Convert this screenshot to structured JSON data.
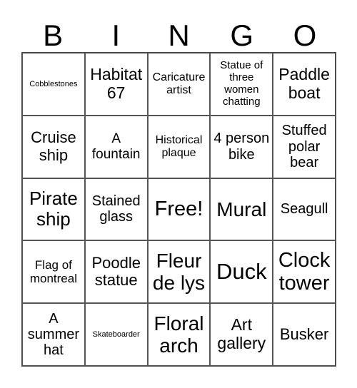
{
  "header": {
    "letters": [
      "B",
      "I",
      "N",
      "G",
      "O"
    ]
  },
  "cells": [
    "Cobblestones",
    "Habitat 67",
    "Caricature artist",
    "Statue of three women chatting",
    "Paddle boat",
    "Cruise ship",
    "A fountain",
    "Historical plaque",
    "4 person bike",
    "Stuffed polar bear",
    "Pirate ship",
    "Stained glass",
    "Free!",
    "Mural",
    "Seagull",
    "Flag of montreal",
    "Poodle statue",
    "Fleur de lys",
    "Duck",
    "Clock tower",
    "A summer hat",
    "Skateboarder",
    "Floral arch",
    "Art gallery",
    "Busker"
  ]
}
